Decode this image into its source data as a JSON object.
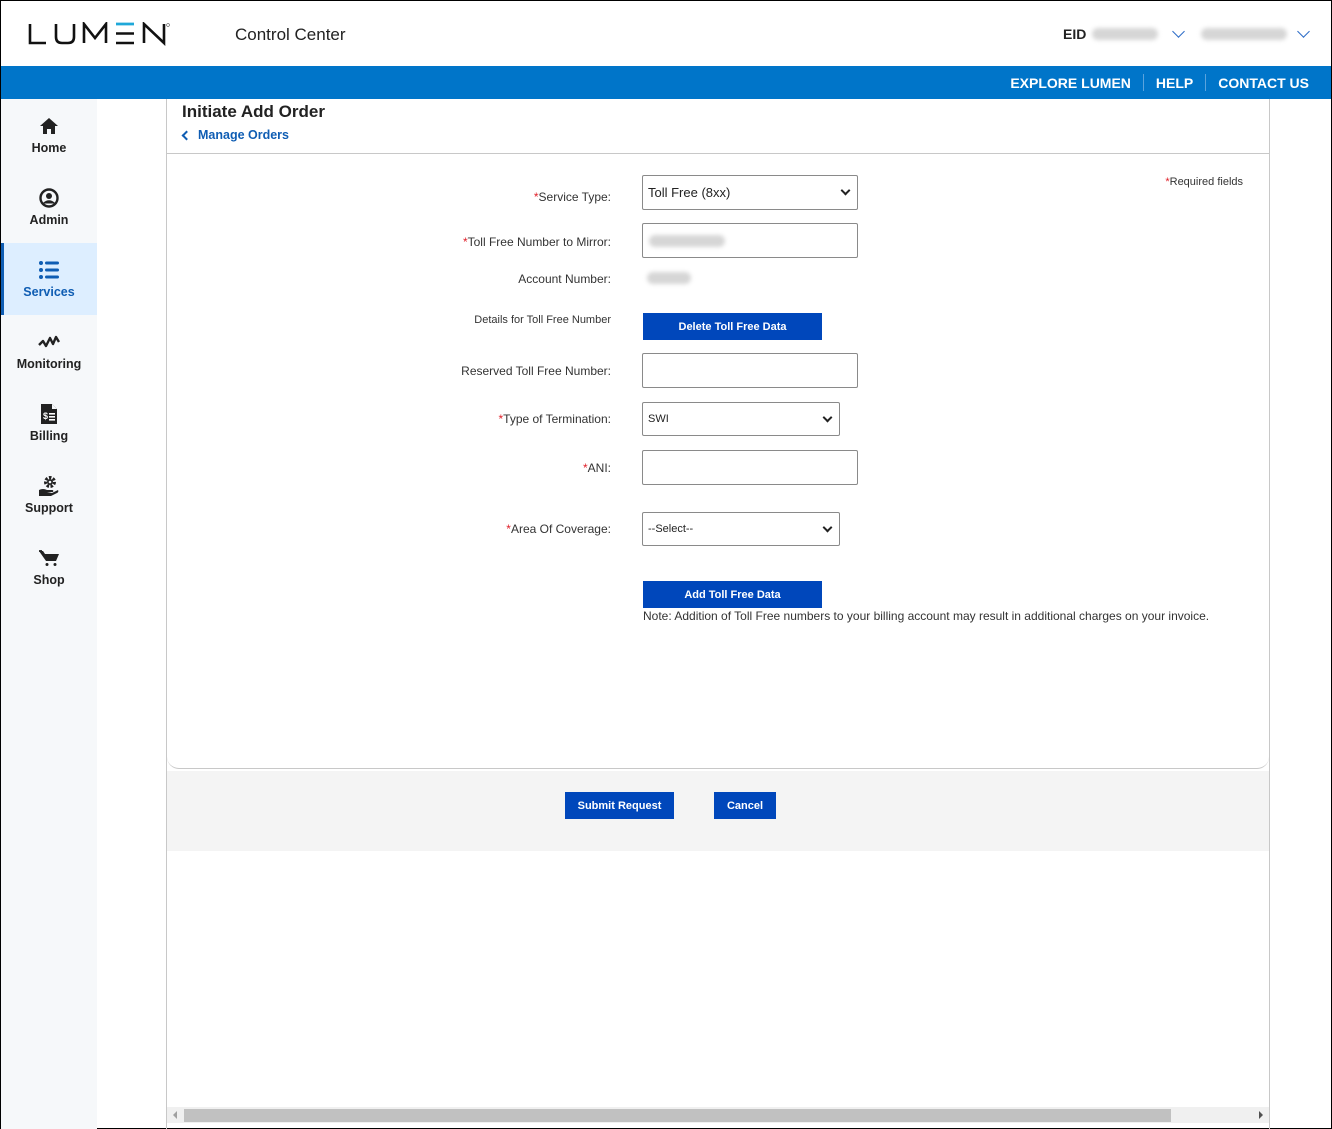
{
  "header": {
    "brand": "LUMEN",
    "app_title": "Control Center",
    "eid_label": "EID",
    "eid_value_masked": true,
    "user_masked": true,
    "colors": {
      "brand_blue": "#0075c9",
      "logo_accent": "#1fa8d9",
      "button_blue": "#0047bb",
      "link_blue": "#0f5db3"
    }
  },
  "top_links": [
    {
      "label": "EXPLORE LUMEN"
    },
    {
      "label": "HELP"
    },
    {
      "label": "CONTACT US"
    }
  ],
  "sidebar": {
    "items": [
      {
        "label": "Home",
        "icon": "home-icon",
        "active": false
      },
      {
        "label": "Admin",
        "icon": "user-circle-icon",
        "active": false
      },
      {
        "label": "Services",
        "icon": "list-icon",
        "active": true
      },
      {
        "label": "Monitoring",
        "icon": "pulse-icon",
        "active": false
      },
      {
        "label": "Billing",
        "icon": "invoice-icon",
        "active": false
      },
      {
        "label": "Support",
        "icon": "support-gear-hand-icon",
        "active": false
      },
      {
        "label": "Shop",
        "icon": "cart-icon",
        "active": false
      }
    ]
  },
  "page": {
    "title": "Initiate Add Order",
    "breadcrumb": "Manage Orders",
    "required_note": "Required fields",
    "required_star": "*"
  },
  "form": {
    "service_type": {
      "label": "Service Type:",
      "required": true,
      "value": "Toll Free (8xx)"
    },
    "toll_free_mirror": {
      "label": "Toll Free Number to Mirror:",
      "required": true,
      "value_masked": true
    },
    "account_number": {
      "label": "Account Number:",
      "value_masked": true
    },
    "details_label": "Details for Toll Free Number",
    "delete_button": "Delete Toll Free Data",
    "reserved_number": {
      "label": "Reserved Toll Free Number:",
      "value": ""
    },
    "termination_type": {
      "label": "Type of Termination:",
      "required": true,
      "value": "SWI"
    },
    "ani": {
      "label": "ANI:",
      "required": true,
      "value": ""
    },
    "area_of_coverage": {
      "label": "Area Of Coverage:",
      "required": true,
      "value": "--Select--"
    },
    "add_button": "Add Toll Free Data",
    "note": "Note: Addition of Toll Free numbers to your billing account may result in additional charges on your invoice."
  },
  "actions": {
    "submit": "Submit Request",
    "cancel": "Cancel"
  }
}
